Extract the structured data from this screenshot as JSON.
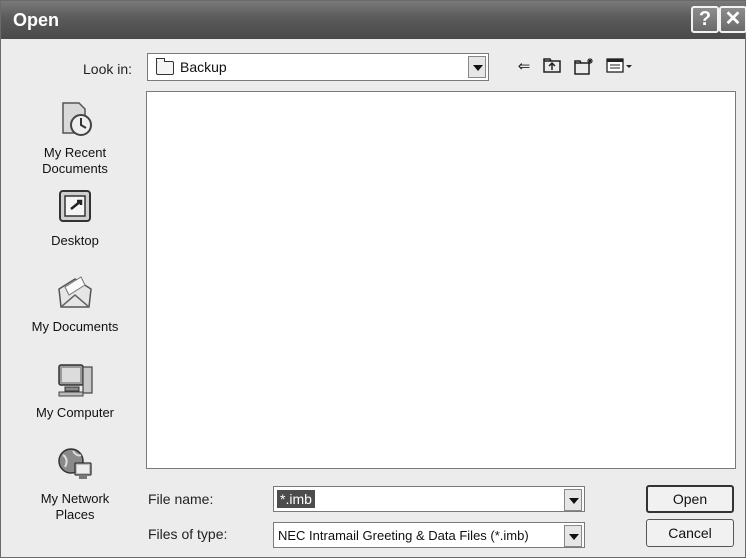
{
  "window": {
    "title": "Open"
  },
  "look_in": {
    "label": "Look in:",
    "value": "Backup"
  },
  "places": [
    {
      "label": "My Recent\nDocuments",
      "icon": "recent-documents-icon"
    },
    {
      "label": "Desktop",
      "icon": "desktop-icon"
    },
    {
      "label": "My Documents",
      "icon": "my-documents-icon"
    },
    {
      "label": "My Computer",
      "icon": "my-computer-icon"
    },
    {
      "label": "My Network\nPlaces",
      "icon": "network-places-icon"
    }
  ],
  "file_name": {
    "label": "File name:",
    "value": "*.imb"
  },
  "file_type": {
    "label": "Files of type:",
    "value": "NEC Intramail Greeting & Data Files (*.imb)"
  },
  "buttons": {
    "open": "Open",
    "cancel": "Cancel"
  }
}
